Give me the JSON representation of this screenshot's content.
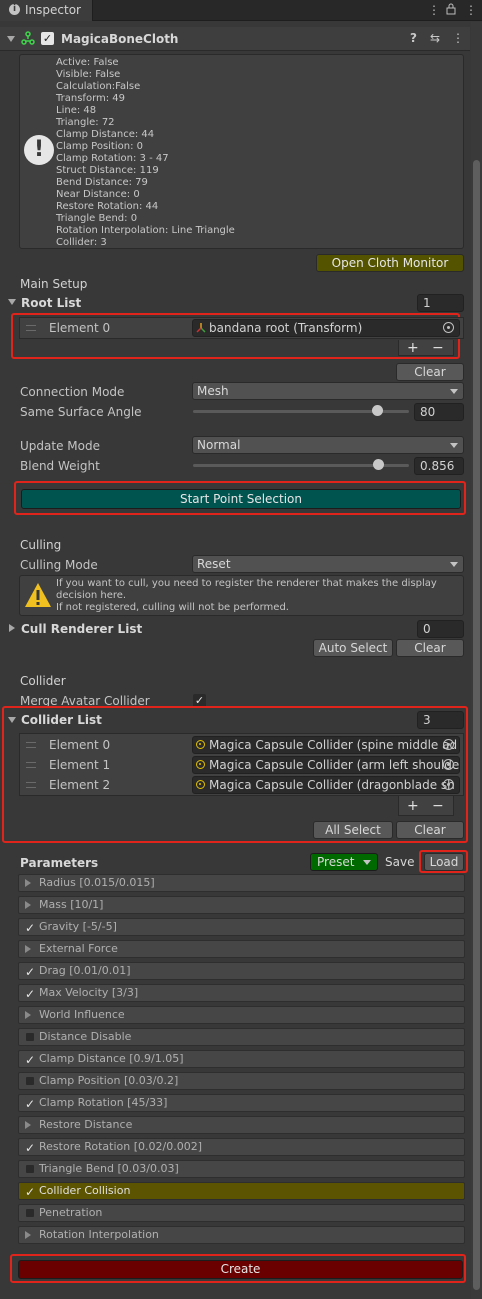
{
  "window": {
    "tab_label": "Inspector",
    "tab_tools": "⋮ 🔒 ⋮"
  },
  "component": {
    "name": "MagicaBoneCloth",
    "header_tools": [
      "?",
      "⇆",
      "⋮"
    ]
  },
  "stats": [
    "Active: False",
    "Visible: False",
    "Calculation:False",
    "Transform: 49",
    "Line: 48",
    "Triangle: 72",
    "Clamp Distance: 44",
    "Clamp Position: 0",
    "Clamp Rotation: 3 - 47",
    "Struct Distance: 119",
    "Bend Distance: 79",
    "Near Distance: 0",
    "Restore Rotation: 44",
    "Triangle Bend: 0",
    "Rotation Interpolation: Line Triangle",
    "Collider: 3"
  ],
  "open_monitor_label": "Open Cloth Monitor",
  "main_setup": {
    "title": "Main Setup",
    "root_list_label": "Root List",
    "root_list_count": "1",
    "root_element_label": "Element 0",
    "root_element_value": "bandana root (Transform)",
    "plus": "+",
    "minus": "−",
    "clear": "Clear"
  },
  "connection_mode": {
    "label": "Connection Mode",
    "value": "Mesh"
  },
  "same_surface_angle": {
    "label": "Same Surface Angle",
    "value": "80",
    "fraction": 0.85
  },
  "update_mode": {
    "label": "Update Mode",
    "value": "Normal"
  },
  "blend_weight": {
    "label": "Blend Weight",
    "value": "0.856",
    "fraction": 0.856
  },
  "start_point_label": "Start Point Selection",
  "culling": {
    "title": "Culling",
    "mode_label": "Culling Mode",
    "mode_value": "Reset",
    "help_line1": "If you want to cull, you need to register the renderer that makes the display",
    "help_line2": "decision here.",
    "help_line3": "If not registered, culling will not be performed.",
    "cull_list_label": "Cull Renderer List",
    "cull_list_count": "0",
    "auto_select": "Auto Select",
    "clear": "Clear"
  },
  "collider": {
    "title": "Collider",
    "merge_label": "Merge Avatar Collider",
    "list_label": "Collider List",
    "list_count": "3",
    "items": [
      {
        "label": "Element 0",
        "value": "Magica Capsule Collider (spine middle ad"
      },
      {
        "label": "Element 1",
        "value": "Magica Capsule Collider (arm left shoulde"
      },
      {
        "label": "Element 2",
        "value": "Magica Capsule Collider (dragonblade sh"
      }
    ],
    "all_select": "All Select",
    "clear": "Clear"
  },
  "parameters": {
    "title": "Parameters",
    "preset": "Preset",
    "save": "Save",
    "load": "Load",
    "items": [
      {
        "label": "Radius [0.015/0.015]",
        "state": "fold"
      },
      {
        "label": "Mass [10/1]",
        "state": "fold"
      },
      {
        "label": "Gravity [-5/-5]",
        "state": "check"
      },
      {
        "label": "External Force",
        "state": "fold"
      },
      {
        "label": "Drag [0.01/0.01]",
        "state": "check"
      },
      {
        "label": "Max Velocity [3/3]",
        "state": "check"
      },
      {
        "label": "World Influence",
        "state": "fold"
      },
      {
        "label": "Distance Disable",
        "state": "off"
      },
      {
        "label": "Clamp Distance [0.9/1.05]",
        "state": "check"
      },
      {
        "label": "Clamp Position [0.03/0.2]",
        "state": "off"
      },
      {
        "label": "Clamp Rotation [45/33]",
        "state": "check"
      },
      {
        "label": "Restore Distance",
        "state": "fold"
      },
      {
        "label": "Restore Rotation [0.02/0.002]",
        "state": "check"
      },
      {
        "label": "Triangle Bend [0.03/0.03]",
        "state": "off"
      },
      {
        "label": "Collider Collision",
        "state": "check-highlight"
      },
      {
        "label": "Penetration",
        "state": "off"
      },
      {
        "label": "Rotation Interpolation",
        "state": "fold"
      }
    ]
  },
  "create_label": "Create",
  "colors": {
    "highlight_red": "#e0241b",
    "start_button": "#005450",
    "monitor_button": "#545400",
    "create_button": "#6a0000",
    "preset_button": "#006a00",
    "collider_collision": "#5c5400"
  }
}
